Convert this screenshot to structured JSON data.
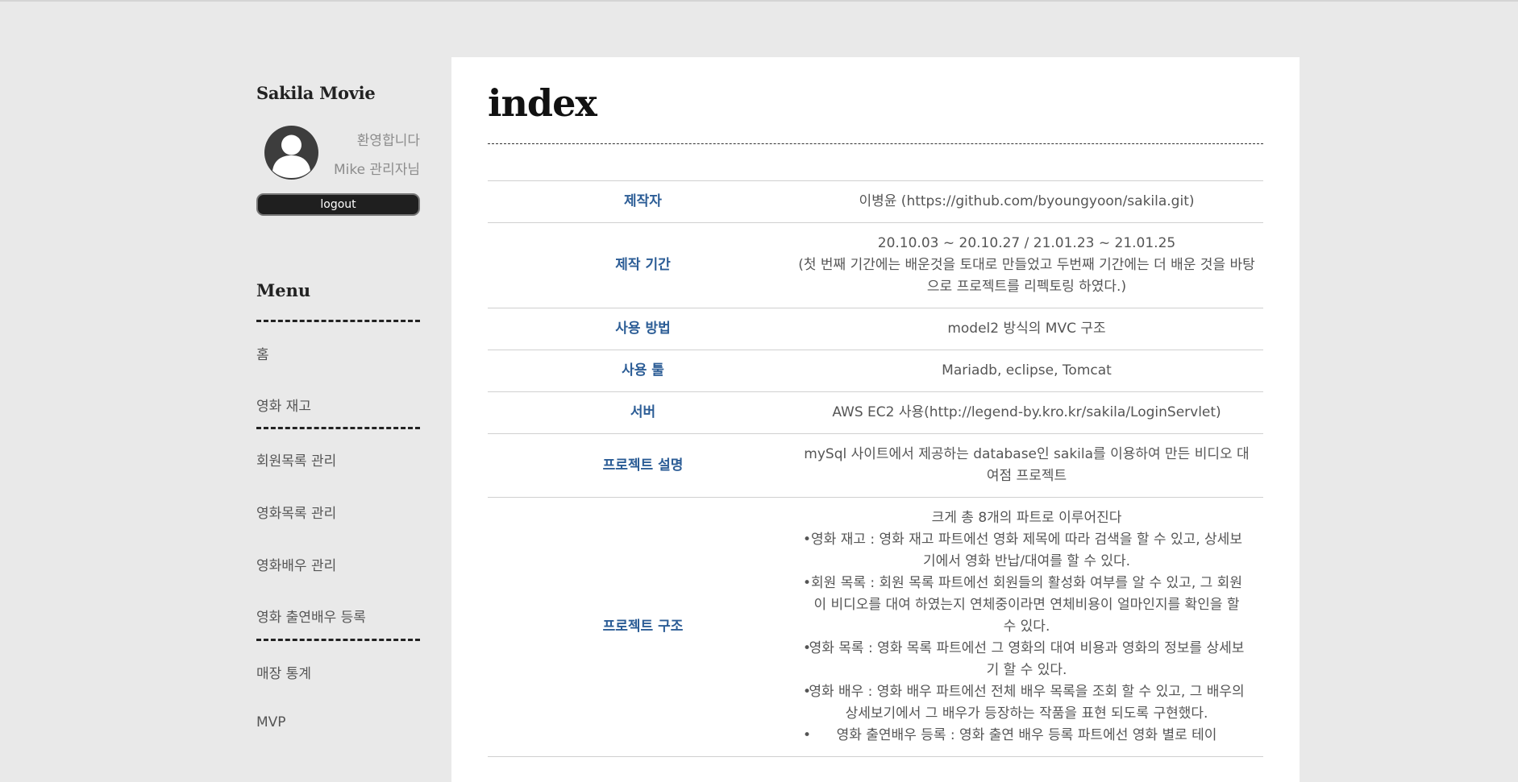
{
  "sidebar": {
    "brand": "Sakila Movie",
    "welcome": "환영합니다",
    "username": "Mike 관리자님",
    "logout_label": "logout",
    "menu_title": "Menu",
    "menu": [
      {
        "label": "홈"
      },
      {
        "label": "영화 재고"
      },
      {
        "label": "회원목록 관리"
      },
      {
        "label": "영화목록 관리"
      },
      {
        "label": "영화배우 관리"
      },
      {
        "label": "영화 출연배우 등록"
      },
      {
        "label": "매장 통계"
      },
      {
        "label": "MVP"
      }
    ]
  },
  "main": {
    "title": "index",
    "rows": [
      {
        "key": "제작자",
        "value": "이병윤 (https://github.com/byoungyoon/sakila.git)"
      },
      {
        "key": "제작 기간",
        "value": "20.10.03 ~ 20.10.27 / 21.01.23 ~ 21.01.25",
        "value2": "(첫 번째 기간에는 배운것을 토대로 만들었고 두번째 기간에는 더 배운 것을 바탕으로 프로젝트를 리펙토링 하였다.)"
      },
      {
        "key": "사용 방법",
        "value": "model2 방식의 MVC 구조"
      },
      {
        "key": "사용 툴",
        "value": "Mariadb, eclipse, Tomcat"
      },
      {
        "key": "서버",
        "value": "AWS EC2 사용(http://legend-by.kro.kr/sakila/LoginServlet)"
      },
      {
        "key": "프로젝트 설명",
        "value": "mySql 사이트에서 제공하는 database인 sakila를 이용하여 만든 비디오 대여점 프로젝트"
      },
      {
        "key": "프로젝트 구조",
        "value": "크게 총 8개의 파트로 이루어진다",
        "bullets": [
          "영화 재고 : 영화 재고 파트에선 영화 제목에 따라 검색을 할 수 있고, 상세보기에서 영화 반납/대여를 할 수 있다.",
          "회원 목록 : 회원 목록 파트에선 회원들의 활성화 여부를 알 수 있고, 그 회원이 비디오를 대여 하였는지 연체중이라면 연체비용이 얼마인지를 확인을 할 수 있다.",
          "영화 목록 : 영화 목록 파트에선 그 영화의 대여 비용과 영화의 정보를 상세보기 할 수 있다.",
          "영화 배우 : 영화 배우 파트에선 전체 배우 목록을 조회 할 수 있고, 그 배우의 상세보기에서 그 배우가 등장하는 작품을 표현 되도록 구현했다.",
          "영화 출연배우 등록 : 영화 출연 배우 등록 파트에선 영화 별로 테이"
        ]
      }
    ]
  }
}
